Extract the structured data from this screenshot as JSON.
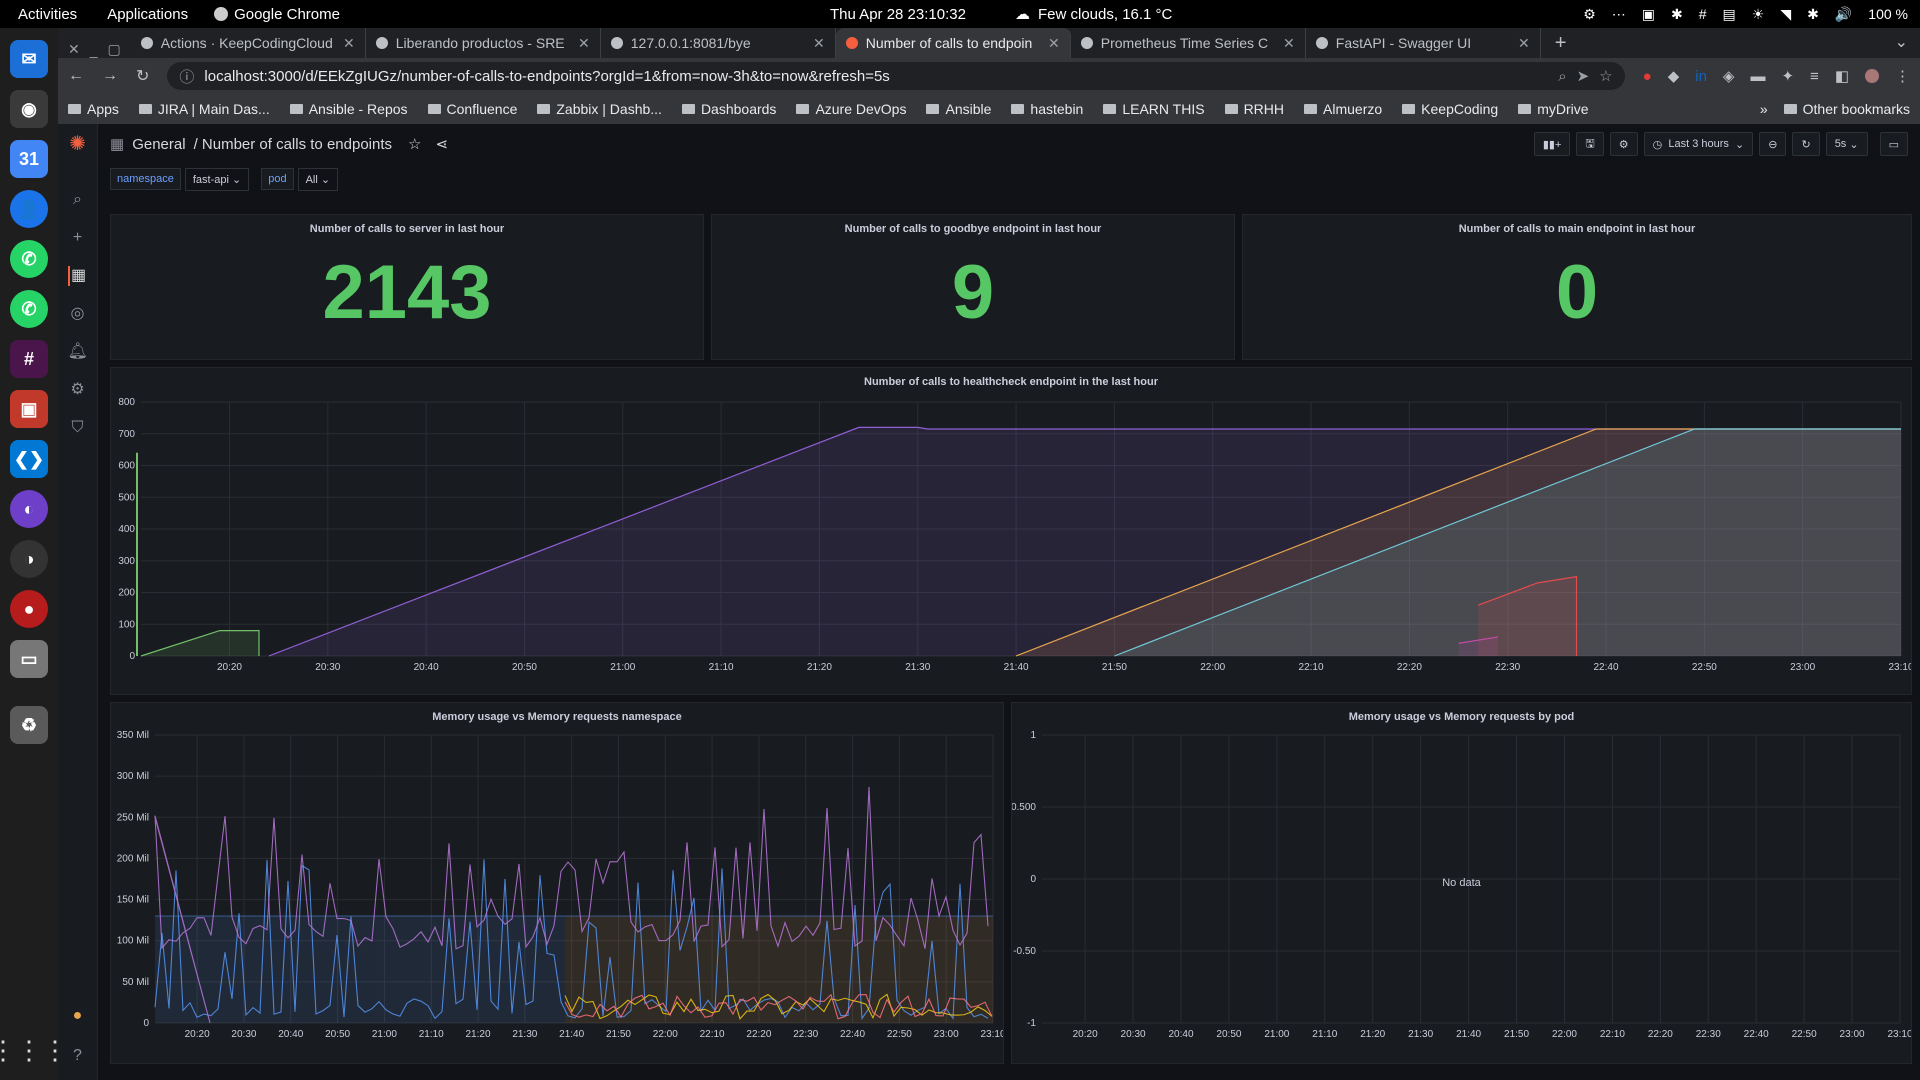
{
  "system_bar": {
    "activities": "Activities",
    "applications": "Applications",
    "app_name": "Google Chrome",
    "clock": "Thu Apr 28  23:10:32",
    "weather": "Few clouds, 16.1 °C",
    "battery": "100 %"
  },
  "tabs": [
    {
      "title": "Actions · KeepCodingCloud",
      "active": false
    },
    {
      "title": "Liberando productos - SRE",
      "active": false
    },
    {
      "title": "127.0.0.1:8081/bye",
      "active": false
    },
    {
      "title": "Number of calls to endpoin",
      "active": true
    },
    {
      "title": "Prometheus Time Series C",
      "active": false
    },
    {
      "title": "FastAPI - Swagger UI",
      "active": false
    }
  ],
  "address_bar": {
    "url": "localhost:3000/d/EEkZgIUGz/number-of-calls-to-endpoints?orgId=1&from=now-3h&to=now&refresh=5s"
  },
  "bookmarks": [
    "Apps",
    "JIRA | Main Das...",
    "Ansible - Repos",
    "Confluence",
    "Zabbix | Dashb...",
    "Dashboards",
    "Azure DevOps",
    "Ansible",
    "hastebin",
    "LEARN THIS",
    "RRHH",
    "Almuerzo",
    "KeepCoding",
    "myDrive"
  ],
  "bookmarks_more": "»",
  "other_bookmarks": "Other bookmarks",
  "dashboard": {
    "breadcrumb_root": "General",
    "title": "/ Number of calls to endpoints",
    "time_range": "Last 3 hours",
    "refresh": "5s",
    "variables": [
      {
        "label": "namespace",
        "value": "fast-api"
      },
      {
        "label": "pod",
        "value": "All"
      }
    ]
  },
  "panels": {
    "stat1": {
      "title": "Number of calls to server in last hour",
      "value": "2143"
    },
    "stat2": {
      "title": "Number of calls to goodbye endpoint in last hour",
      "value": "9"
    },
    "stat3": {
      "title": "Number of calls to main endpoint in last hour",
      "value": "0"
    },
    "health": {
      "title": "Number of calls to healthcheck endpoint in the last hour"
    },
    "mem_ns": {
      "title": "Memory usage vs Memory requests namespace"
    },
    "mem_pod": {
      "title": "Memory usage vs Memory requests by pod",
      "no_data": "No data"
    }
  },
  "chart_data": [
    {
      "id": "health",
      "type": "area",
      "x_ticks": [
        "20:20",
        "20:30",
        "20:40",
        "20:50",
        "21:00",
        "21:10",
        "21:20",
        "21:30",
        "21:40",
        "21:50",
        "22:00",
        "22:10",
        "22:20",
        "22:30",
        "22:40",
        "22:50",
        "23:00",
        "23:10"
      ],
      "y_ticks": [
        "0",
        "100",
        "200",
        "300",
        "400",
        "500",
        "600",
        "700",
        "800"
      ],
      "ylim": [
        0,
        800
      ],
      "series": [
        {
          "color": "#73bf69",
          "points": [
            [
              "20:11",
              0
            ],
            [
              "20:19",
              80
            ],
            [
              "20:23",
              80
            ],
            [
              "20:23",
              0
            ]
          ]
        },
        {
          "color": "#8f5fd6",
          "points": [
            [
              "20:24",
              0
            ],
            [
              "21:24",
              720
            ],
            [
              "21:30",
              720
            ],
            [
              "21:31",
              715
            ],
            [
              "23:10",
              715
            ]
          ]
        },
        {
          "color": "#e8a54f",
          "points": [
            [
              "21:40",
              0
            ],
            [
              "22:39",
              715
            ],
            [
              "23:10",
              715
            ]
          ]
        },
        {
          "color": "#70c9d8",
          "points": [
            [
              "21:50",
              0
            ],
            [
              "22:49",
              715
            ],
            [
              "23:10",
              715
            ]
          ]
        },
        {
          "color": "#e04c4c",
          "points": [
            [
              "22:27",
              160
            ],
            [
              "22:33",
              230
            ],
            [
              "22:37",
              250
            ],
            [
              "22:37",
              0
            ]
          ]
        },
        {
          "color": "#c94ba8",
          "points": [
            [
              "22:25",
              40
            ],
            [
              "22:29",
              60
            ]
          ]
        }
      ]
    },
    {
      "id": "mem_ns",
      "type": "line",
      "x_ticks": [
        "20:20",
        "20:30",
        "20:40",
        "20:50",
        "21:00",
        "21:10",
        "21:20",
        "21:30",
        "21:40",
        "21:50",
        "22:00",
        "22:10",
        "22:20",
        "22:30",
        "22:40",
        "22:50",
        "23:00",
        "23:10"
      ],
      "y_ticks": [
        "0",
        "50 Mil",
        "100 Mil",
        "150 Mil",
        "200 Mil",
        "250 Mil",
        "300 Mil",
        "350 Mil"
      ],
      "ylim": [
        0,
        350
      ],
      "series": [
        {
          "name": "",
          "color": "#5794f2"
        },
        {
          "name": "",
          "color": "#b877d9"
        },
        {
          "name": "",
          "color": "#f2cc0c"
        },
        {
          "name": "",
          "color": "#ff7383"
        }
      ]
    },
    {
      "id": "mem_pod",
      "type": "line",
      "x_ticks": [
        "20:20",
        "20:30",
        "20:40",
        "20:50",
        "21:00",
        "21:10",
        "21:20",
        "21:30",
        "21:40",
        "21:50",
        "22:00",
        "22:10",
        "22:20",
        "22:30",
        "22:40",
        "22:50",
        "23:00",
        "23:10"
      ],
      "y_ticks": [
        "-1",
        "-0.50",
        "0",
        "0.500",
        "1"
      ],
      "ylim": [
        -1,
        1
      ],
      "series": []
    }
  ]
}
